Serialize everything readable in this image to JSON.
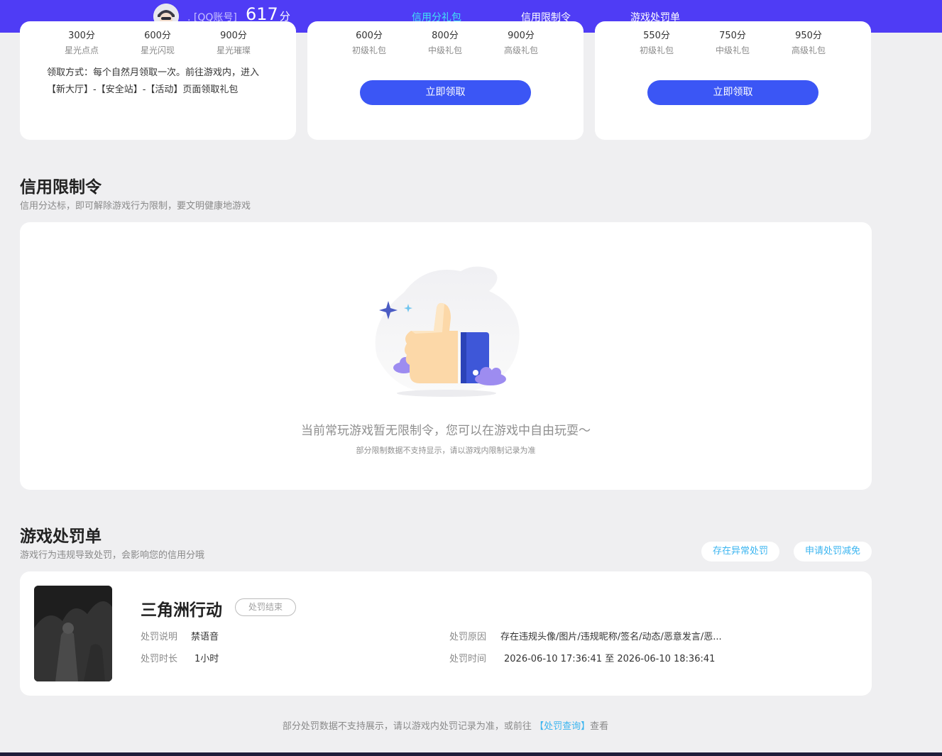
{
  "header": {
    "account_label": ". [QQ账号]",
    "score": "617",
    "score_unit": "分",
    "tabs": [
      {
        "label": "信用分礼包",
        "active": true
      },
      {
        "label": "信用限制令",
        "active": false
      },
      {
        "label": "游戏处罚单",
        "active": false
      }
    ],
    "colors": {
      "bar": "#4f3cf5",
      "active_tab": "#41e3f5"
    }
  },
  "gift_cards": [
    {
      "tiers": [
        {
          "points": "300分",
          "name": "星光点点"
        },
        {
          "points": "600分",
          "name": "星光闪现"
        },
        {
          "points": "900分",
          "name": "星光璀璨"
        }
      ],
      "claim_method": "领取方式：每个自然月领取一次。前往游戏内，进入【新大厅】-【安全站】-【活动】页面领取礼包"
    },
    {
      "tiers": [
        {
          "points": "600分",
          "name": "初级礼包"
        },
        {
          "points": "800分",
          "name": "中级礼包"
        },
        {
          "points": "900分",
          "name": "高级礼包"
        }
      ],
      "button": "立即领取"
    },
    {
      "tiers": [
        {
          "points": "550分",
          "name": "初级礼包"
        },
        {
          "points": "750分",
          "name": "中级礼包"
        },
        {
          "points": "950分",
          "name": "高级礼包"
        }
      ],
      "button": "立即领取"
    }
  ],
  "restriction": {
    "title": "信用限制令",
    "subtitle": "信用分达标，即可解除游戏行为限制，要文明健康地游戏",
    "empty_message": "当前常玩游戏暂无限制令，您可以在游戏中自由玩耍～",
    "empty_note": "部分限制数据不支持显示，请以游戏内限制记录为准",
    "illustration_icon": "thumbs-up-icon"
  },
  "penalty": {
    "title": "游戏处罚单",
    "subtitle": "游戏行为违规导致处罚，会影响您的信用分哦",
    "actions": [
      "存在异常处罚",
      "申请处罚减免"
    ],
    "records": [
      {
        "game": "三角洲行动",
        "status": "处罚结束",
        "desc_label": "处罚说明",
        "desc": "禁语音",
        "duration_label": "处罚时长",
        "duration": "1小时",
        "reason_label": "处罚原因",
        "reason": "存在违规头像/图片/违规昵称/签名/动态/恶意发言/恶...",
        "time_label": "处罚时间",
        "time": "2026-06-10 17:36:41 至 2026-06-10 18:36:41"
      }
    ],
    "footer_prefix": "部分处罚数据不支持展示，请以游戏内处罚记录为准，或前往",
    "footer_link": "【处罚查询】",
    "footer_suffix": "查看",
    "link_color": "#3bb5f0"
  }
}
